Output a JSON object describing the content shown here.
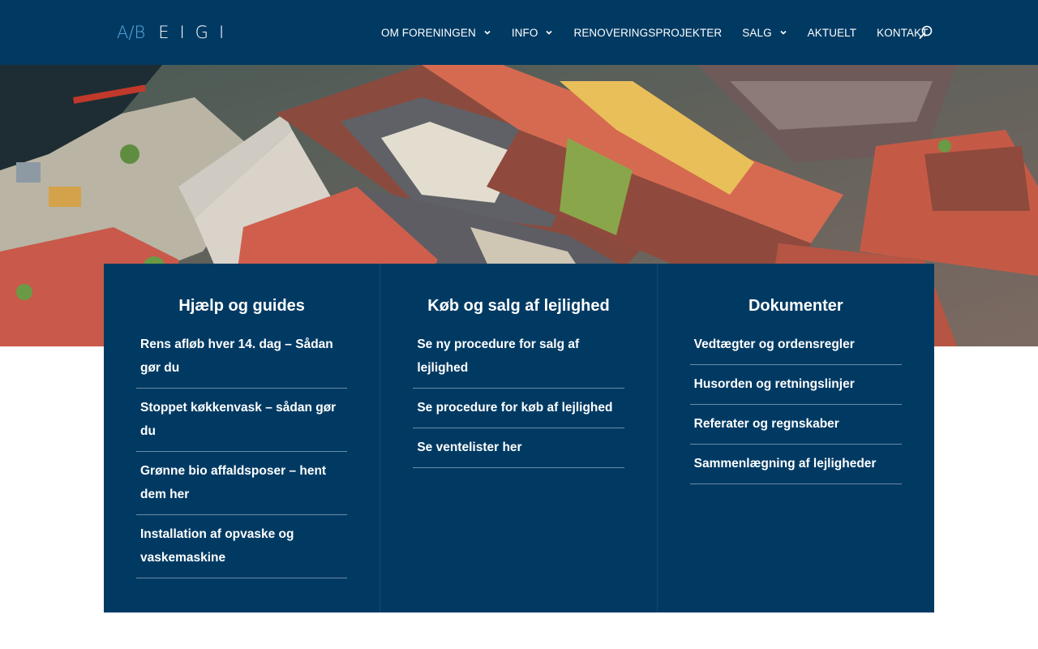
{
  "header": {
    "logo_ab": "A/B",
    "logo_name": "EIGI",
    "nav": [
      {
        "label": "OM FORENINGEN",
        "has_dropdown": true
      },
      {
        "label": "INFO",
        "has_dropdown": true
      },
      {
        "label": "RENOVERINGSPROJEKTER",
        "has_dropdown": false
      },
      {
        "label": "SALG",
        "has_dropdown": true
      },
      {
        "label": "AKTUELT",
        "has_dropdown": false
      },
      {
        "label": "KONTAKT",
        "has_dropdown": false
      }
    ],
    "search_icon": "search-icon"
  },
  "colors": {
    "header_bg": "#003a63",
    "panel_bg": "#003a63",
    "logo_accent": "#5aa7de",
    "text": "#ffffff"
  },
  "columns": [
    {
      "title": "Hjælp og guides",
      "links": [
        "Rens afløb hver 14. dag – Sådan gør du",
        "Stoppet køkkenvask – sådan gør du",
        "Grønne bio affaldsposer – hent dem her",
        "Installation af opvaske og vaskemaskine"
      ]
    },
    {
      "title": "Køb og salg af lejlighed",
      "links": [
        "Se ny procedure for salg af lejlighed",
        "Se procedure for køb af lejlighed",
        "Se ventelister her"
      ]
    },
    {
      "title": "Dokumenter",
      "links": [
        "Vedtægter og ordensregler",
        "Husorden og retningslinjer",
        "Referater og regnskaber",
        "Sammenlægning af lejligheder"
      ]
    }
  ]
}
